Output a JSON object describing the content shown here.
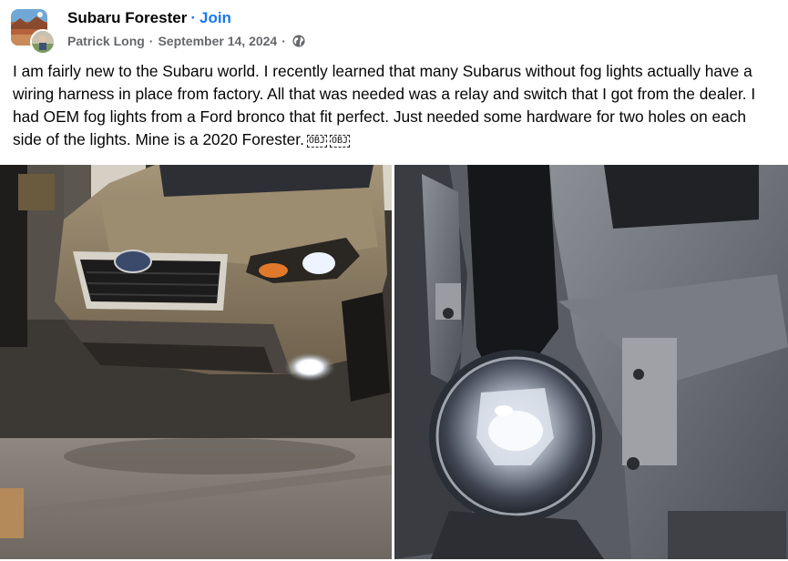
{
  "post": {
    "group_name": "Subaru Forester",
    "separator": "·",
    "join_label": "Join",
    "author": "Patrick Long",
    "meta_separator": "·",
    "date": "September 14, 2024",
    "privacy_icon": "globe-icon",
    "body": "I am fairly new to the Subaru world. I recently learned that many Subarus without fog lights actually have a wiring harness in place from factory. All that was needed was a relay and switch that I got from the dealer. I had OEM fog lights from a Ford bronco that fit perfect. Just needed some hardware for two holes on each side of the lights. Mine is a 2020 Forester.",
    "obj_glyph_1": "OBJ",
    "obj_glyph_2": "OBJ"
  },
  "colors": {
    "link_blue": "#1877f2",
    "secondary_text": "#65676b",
    "primary_text": "#050505"
  },
  "photos": [
    {
      "subject": "photo-subaru-front-fog-light"
    },
    {
      "subject": "photo-fog-light-closeup"
    }
  ]
}
